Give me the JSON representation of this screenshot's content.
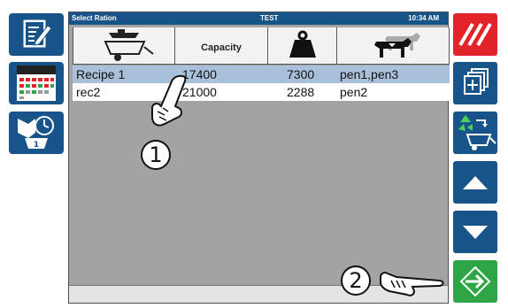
{
  "titlebar": {
    "left": "Select Ration",
    "center": "TEST",
    "right": "10:34 AM"
  },
  "table": {
    "capacity_header": "Capacity",
    "rows": [
      {
        "recipe": "Recipe 1",
        "capacity": "17400",
        "weight": "7300",
        "pens": "pen1,pen3",
        "selected": true
      },
      {
        "recipe": "rec2",
        "capacity": "21000",
        "weight": "2288",
        "pens": "pen2",
        "selected": false
      }
    ]
  },
  "markers": {
    "one": "1",
    "two": "2"
  },
  "icons": {
    "left": [
      "edit-note-icon",
      "calendar-icon",
      "pen-clock-icon"
    ],
    "right": [
      "cancel-stripes-icon",
      "add-copy-icon",
      "recycle-mixer-icon",
      "arrow-up-icon",
      "arrow-down-icon",
      "enter-arrow-icon"
    ]
  },
  "colors": {
    "brand_blue": "#17548a",
    "cancel_red": "#e2232a",
    "confirm_green": "#2ea646",
    "selected_row": "#a9c0da",
    "panel_gray": "#a3a3a3"
  }
}
